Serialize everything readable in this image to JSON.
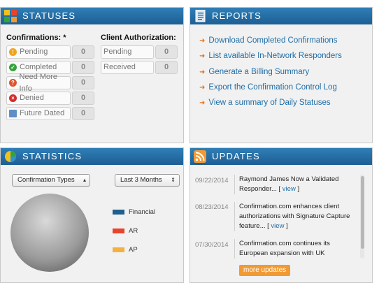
{
  "statuses": {
    "title": "STATUSES",
    "confirmations_title": "Confirmations: *",
    "client_auth_title": "Client Authorization:",
    "confirmations": [
      {
        "label": "Pending",
        "count": "0",
        "icon": "warning-icon",
        "color": "#f1a21c"
      },
      {
        "label": "Completed",
        "count": "0",
        "icon": "check-icon",
        "color": "#36a23a"
      },
      {
        "label": "Need More Info",
        "count": "0",
        "icon": "question-icon",
        "color": "#e0532a"
      },
      {
        "label": "Denied",
        "count": "0",
        "icon": "denied-icon",
        "color": "#d62b2b"
      },
      {
        "label": "Future Dated",
        "count": "0",
        "icon": "calendar-icon",
        "color": "#5f8fc4"
      }
    ],
    "client_auth": [
      {
        "label": "Pending",
        "count": "0"
      },
      {
        "label": "Received",
        "count": "0"
      }
    ]
  },
  "reports": {
    "title": "REPORTS",
    "links": [
      "Download Completed Confirmations",
      "List available In-Network Responders",
      "Generate a Billing Summary",
      "Export the Confirmation Control Log",
      "View a summary of Daily Statuses"
    ]
  },
  "statistics": {
    "title": "STATISTICS",
    "type_select": "Confirmation Types",
    "range_select": "Last 3 Months",
    "legend": [
      {
        "name": "Financial",
        "color": "#1f5f8f"
      },
      {
        "name": "AR",
        "color": "#e8432b"
      },
      {
        "name": "AP",
        "color": "#f5b042"
      }
    ]
  },
  "updates": {
    "title": "UPDATES",
    "items": [
      {
        "date": "09/22/2014",
        "text": "Raymond James Now a Validated Responder... [",
        "link": " view ",
        "tail": "]"
      },
      {
        "date": "08/23/2014",
        "text": "Confirmation.com enhances client authorizations with Signature Capture feature... [",
        "link": " view ",
        "tail": "]"
      },
      {
        "date": "07/30/2014",
        "text": "Confirmation.com continues its European expansion with UK",
        "link": "",
        "tail": ""
      }
    ],
    "more_label": "more updates"
  },
  "colors": {
    "header": "#2a73ad",
    "link": "#1f6ea8",
    "accent": "#e0731d"
  }
}
